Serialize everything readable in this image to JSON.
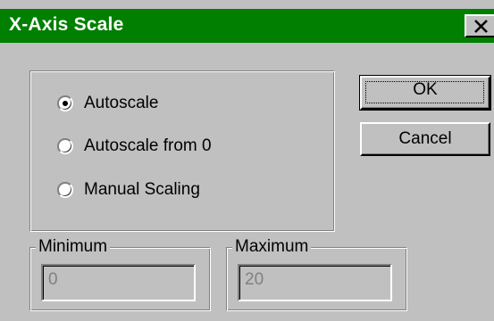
{
  "window": {
    "title": "X-Axis Scale",
    "close_icon": "close-x-icon"
  },
  "scale_options": {
    "items": [
      {
        "label": "Autoscale",
        "selected": true
      },
      {
        "label": "Autoscale from 0",
        "selected": false
      },
      {
        "label": "Manual Scaling",
        "selected": false
      }
    ]
  },
  "buttons": {
    "ok_label": "OK",
    "cancel_label": "Cancel"
  },
  "minimum": {
    "label": "Minimum",
    "value": "0",
    "enabled": false
  },
  "maximum": {
    "label": "Maximum",
    "value": "20",
    "enabled": false
  },
  "colors": {
    "titlebar": "#007f00",
    "face": "#c0c0c0",
    "disabled_text": "#808080"
  }
}
